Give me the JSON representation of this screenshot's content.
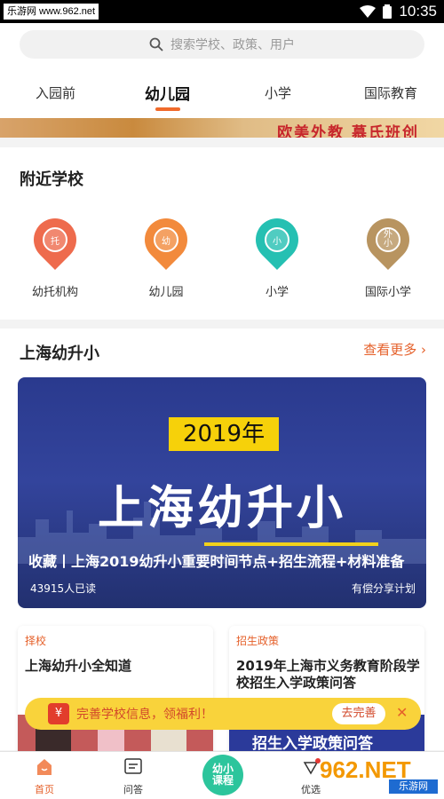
{
  "status": {
    "site": "乐游网 www.962.net",
    "time": "10:35"
  },
  "search": {
    "placeholder": "搜索学校、政策、用户"
  },
  "tabs": [
    {
      "label": "入园前"
    },
    {
      "label": "幼儿园",
      "active": true
    },
    {
      "label": "小学"
    },
    {
      "label": "国际教育"
    }
  ],
  "banner": {
    "text": "欧美外教 慕氏班创"
  },
  "nearby": {
    "title": "附近学校",
    "items": [
      {
        "label": "幼托机构",
        "badge": "托",
        "color": "#ee6b4d"
      },
      {
        "label": "幼儿园",
        "badge": "幼",
        "color": "#f28a3c"
      },
      {
        "label": "小学",
        "badge": "小",
        "color": "#25c0b2"
      },
      {
        "label": "国际小学",
        "badge": "外\n小",
        "color": "#b89460"
      }
    ]
  },
  "section": {
    "title": "上海幼升小",
    "more": "查看更多"
  },
  "featured": {
    "year": "2019年",
    "headline": "上海幼升小",
    "caption": "收藏丨上海2019幼升小重要时间节点+招生流程+材料准备",
    "reads": "43915人已读",
    "share": "有偿分享计划"
  },
  "cards": [
    {
      "tag": "择校",
      "title": "上海幼升小全知道"
    },
    {
      "tag": "招生政策",
      "title": "2019年上海市义务教育阶段学校招生入学政策问答",
      "image_text": "招生入学政策问答"
    }
  ],
  "toast": {
    "gift_icon": "¥",
    "message": "完善学校信息，领福利！",
    "button": "去完善"
  },
  "tabbar": [
    {
      "label": "首页",
      "active": true
    },
    {
      "label": "问答"
    },
    {
      "label": "幼小\n课程"
    },
    {
      "label": "优选"
    }
  ],
  "watermark": {
    "logo": "962.NET",
    "sub": "乐游网"
  },
  "colors": {
    "accent": "#e5602a",
    "toast": "#f9d33b",
    "featured_bg": "#2a3a8e"
  }
}
